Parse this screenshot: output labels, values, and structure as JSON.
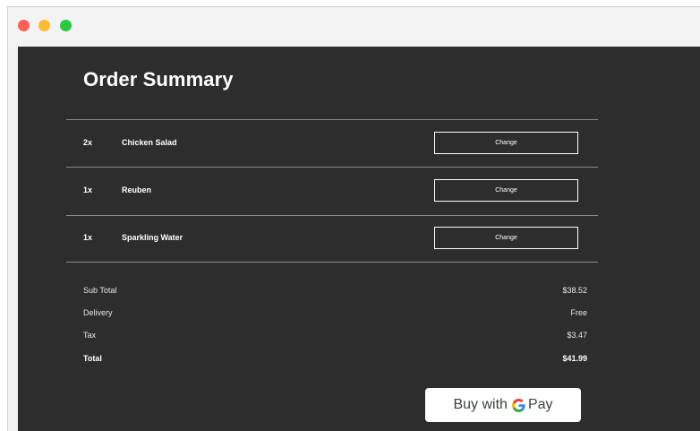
{
  "window": {
    "controls": [
      "close",
      "minimize",
      "maximize"
    ]
  },
  "order": {
    "title": "Order Summary",
    "items": [
      {
        "qty": "2x",
        "name": "Chicken Salad",
        "action": "Change"
      },
      {
        "qty": "1x",
        "name": "Reuben",
        "action": "Change"
      },
      {
        "qty": "1x",
        "name": "Sparkling Water",
        "action": "Change"
      }
    ],
    "summary": {
      "subtotal_label": "Sub Total",
      "subtotal_value": "$38.52",
      "delivery_label": "Delivery",
      "delivery_value": "Free",
      "tax_label": "Tax",
      "tax_value": "$3.47",
      "total_label": "Total",
      "total_value": "$41.99"
    },
    "pay_button": {
      "prefix": "Buy with",
      "brand_letter": "G",
      "suffix": "Pay",
      "icon": "google-g-icon"
    }
  },
  "colors": {
    "panel_bg": "#2d2d2d",
    "titlebar_bg": "#f3f3f3",
    "close": "#ff5f57",
    "minimize": "#febc2e",
    "maximize": "#28c840",
    "google_blue": "#4285f4",
    "google_red": "#ea4335",
    "google_yellow": "#fbbc05",
    "google_green": "#34a853"
  }
}
